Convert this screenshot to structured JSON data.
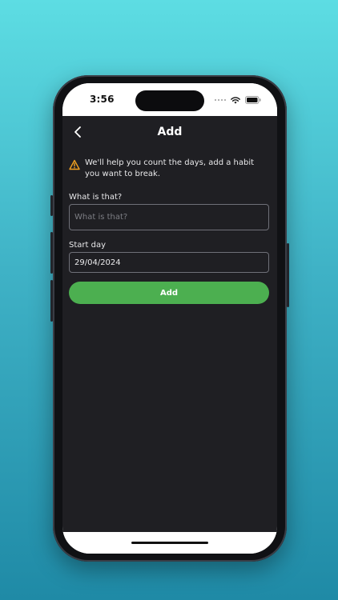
{
  "status_bar": {
    "time": "3:56",
    "icons": [
      "signal-dots-icon",
      "wifi-icon",
      "battery-icon"
    ]
  },
  "nav": {
    "back_icon": "chevron-left-icon",
    "title": "Add"
  },
  "notice": {
    "icon": "warning-triangle-icon",
    "text": "We'll help you count the days, add a habit you want to break."
  },
  "form": {
    "habit": {
      "label": "What is that?",
      "value": "",
      "placeholder": "What is that?"
    },
    "start": {
      "label": "Start day",
      "value": "29/04/2024"
    },
    "submit_label": "Add"
  },
  "colors": {
    "background_top": "#5ddde3",
    "background_bottom": "#1f8aa6",
    "app_background": "#1f1f23",
    "accent_button": "#4caf50",
    "warning": "#f0a020"
  }
}
